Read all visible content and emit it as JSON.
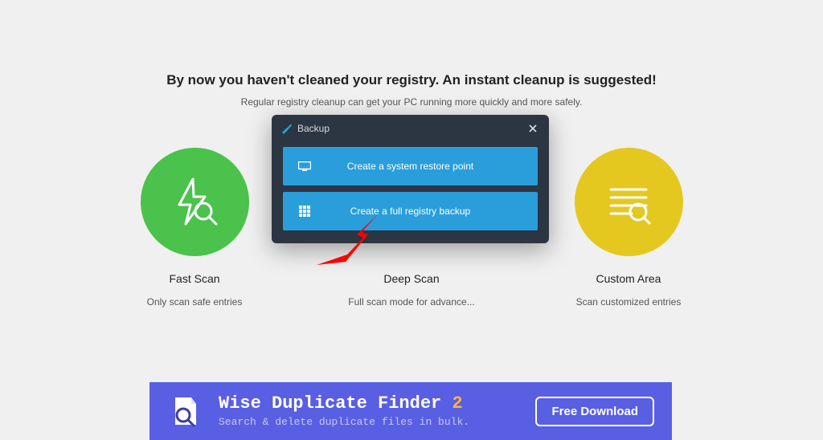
{
  "headline": "By now you haven't cleaned your registry. An instant cleanup is suggested!",
  "subhead": "Regular registry cleanup can get your PC running more quickly and more safely.",
  "options": {
    "fast": {
      "title": "Fast Scan",
      "desc": "Only scan safe entries"
    },
    "deep": {
      "title": "Deep Scan",
      "desc": "Full scan mode for advance..."
    },
    "custom": {
      "title": "Custom Area",
      "desc": "Scan customized entries"
    }
  },
  "dialog": {
    "title": "Backup",
    "restore_label": "Create a system restore point",
    "fullbackup_label": "Create a full registry backup"
  },
  "banner": {
    "title_part1": "Wise Duplicate Finder ",
    "title_part2": "2",
    "sub": "Search & delete duplicate files in bulk.",
    "button": "Free Download"
  }
}
